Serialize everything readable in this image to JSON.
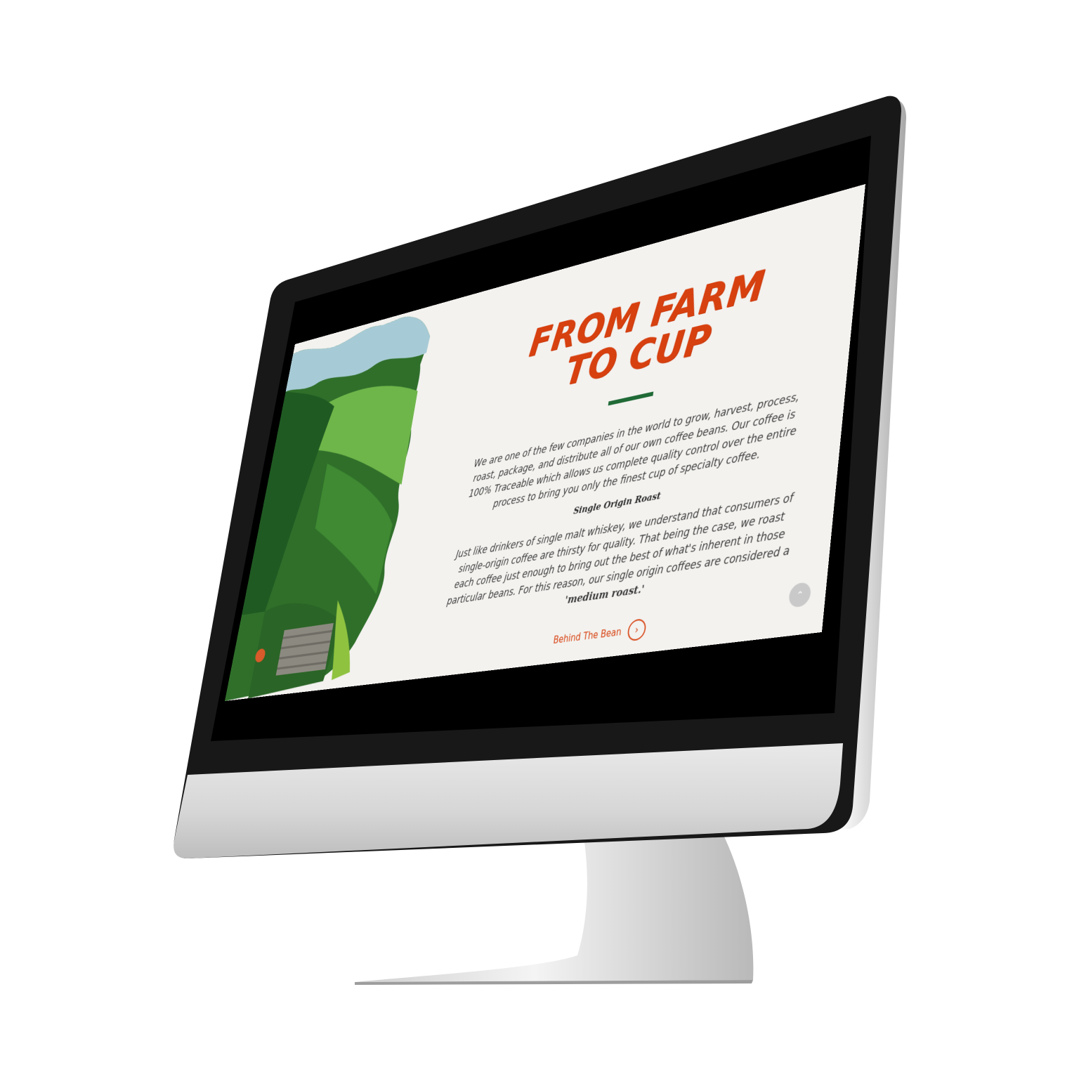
{
  "page": {
    "heading": "FROM FARM TO CUP",
    "intro": "We are one of the few companies in the world to grow, harvest, process, roast, package, and distribute all of our own coffee beans. Our coffee is 100% Traceable which allows us complete quality control over the entire process to bring you only the finest cup of specialty coffee.",
    "subheading": "Single Origin Roast",
    "body_text": "Just like drinkers of single malt whiskey, we understand that consumers of single-origin coffee are thirsty for quality.  That being the case, we roast each coffee just enough to bring out the best of what's inherent in those particular beans.  For this reason, our single origin coffees are considered a",
    "body_emphasis": "'medium roast.'",
    "cta_label": "Behind The Bean",
    "cta_icon": "chevron-right-icon",
    "scroll_top_icon": "chevron-up-icon"
  },
  "colors": {
    "accent": "#d7400f",
    "divider": "#1f6a36",
    "page_background": "#f3f2ef",
    "screen_bezel": "#141414",
    "chin": "#d9d9d9"
  }
}
